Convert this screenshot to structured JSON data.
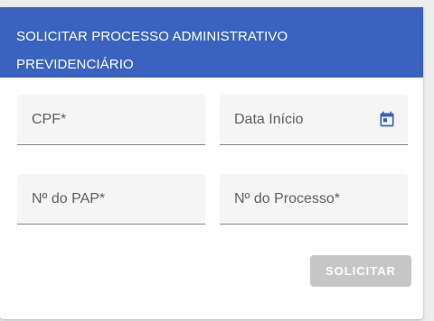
{
  "header": {
    "title_line1": "SOLICITAR PROCESSO ADMINISTRATIVO",
    "title_line2": "PREVIDENCIÁRIO"
  },
  "form": {
    "cpf_label": "CPF*",
    "data_inicio_label": "Data Início",
    "pap_label": "Nº do PAP*",
    "processo_label": "Nº do Processo*",
    "calendar_icon": "calendar-icon",
    "accent_color": "#3a63bf"
  },
  "actions": {
    "submit_label": "SOLICITAR",
    "submit_disabled": true
  }
}
